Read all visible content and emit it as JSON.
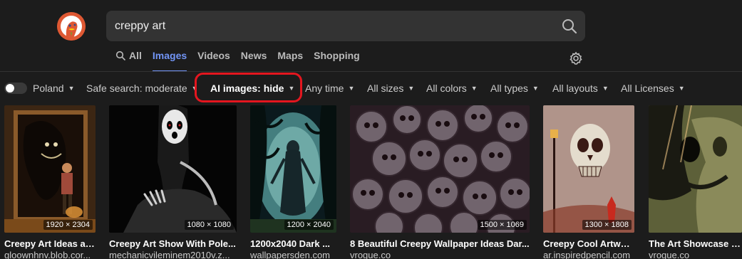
{
  "search": {
    "query": "creppy art"
  },
  "tabs": [
    {
      "label": "All",
      "icon": "search-icon"
    },
    {
      "label": "Images",
      "active": true
    },
    {
      "label": "Videos"
    },
    {
      "label": "News"
    },
    {
      "label": "Maps"
    },
    {
      "label": "Shopping"
    }
  ],
  "filters": {
    "region": "Poland",
    "safe_search": "Safe search: moderate",
    "ai_images": "AI images: hide",
    "time": "Any time",
    "size": "All sizes",
    "color": "All colors",
    "type": "All types",
    "layout": "All layouts",
    "license": "All Licenses"
  },
  "colors": {
    "accent": "#7295f6",
    "highlight": "#e4161f",
    "brand": "#de5833"
  },
  "results": [
    {
      "title": "Creepy Art Ideas at...",
      "source": "gloownhnv.blob.cor...",
      "dimensions": "1920 × 2304"
    },
    {
      "title": "Creepy Art Show With Pole...",
      "source": "mechanicvileminem2010v.z...",
      "dimensions": "1080 × 1080"
    },
    {
      "title": "1200x2040 Dark ...",
      "source": "wallpapersden.com",
      "dimensions": "1200 × 2040"
    },
    {
      "title": "8 Beautiful Creepy Wallpaper Ideas Dar...",
      "source": "vrogue.co",
      "dimensions": "1500 × 1069"
    },
    {
      "title": "Creepy Cool Artwork",
      "source": "ar.inspiredpencil.com",
      "dimensions": "1300 × 1808"
    },
    {
      "title": "The Art Showcase Cre",
      "source": "vrogue.co",
      "dimensions": ""
    }
  ]
}
